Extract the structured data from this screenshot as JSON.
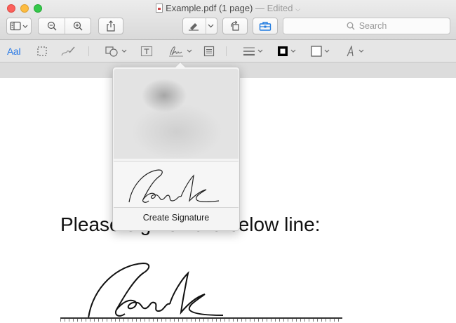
{
  "window": {
    "filename": "Example.pdf",
    "page_count": "(1 page)",
    "status": "— Edited"
  },
  "toolbar": {
    "search_placeholder": "Search"
  },
  "markup": {
    "text_tool_label": "AaI"
  },
  "popover": {
    "create_signature_label": "Create Signature"
  },
  "document": {
    "instruction_text": "Please sign on the below line:"
  },
  "colors": {
    "close": "#fc605b",
    "minimize": "#fdbc40",
    "maximize": "#34c84a",
    "accent": "#1f7ae0"
  }
}
